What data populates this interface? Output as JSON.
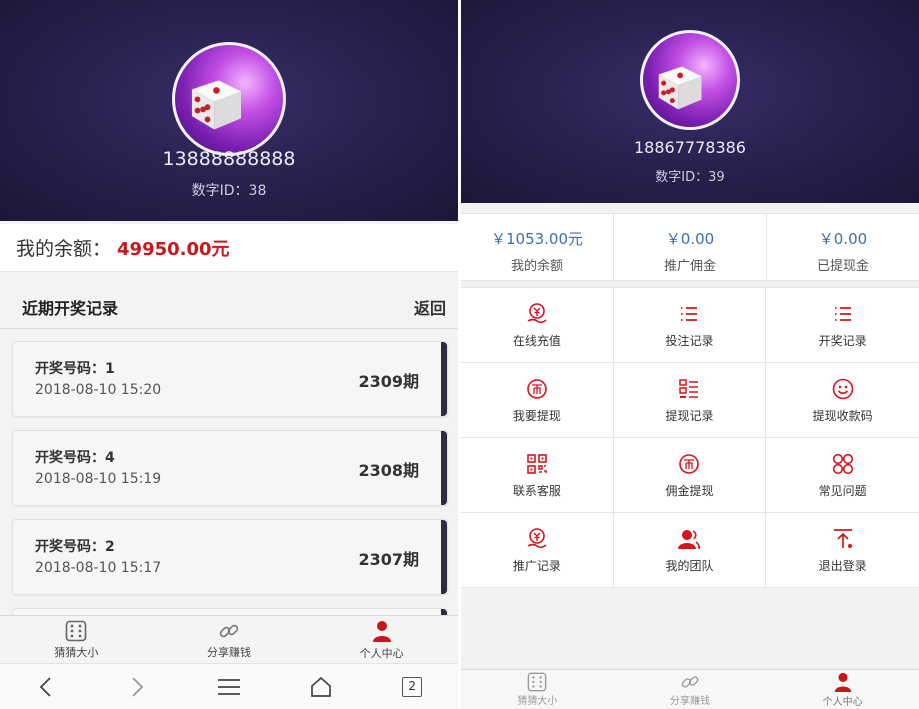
{
  "left": {
    "phone": "13888888888",
    "uid": "数字ID：38",
    "balance_label": "我的余额：",
    "balance_value": "49950.00元",
    "records_title": "近期开奖记录",
    "back_label": "返回",
    "records": [
      {
        "num": "开奖号码：1",
        "time": "2018-08-10 15:20",
        "period": "2309期"
      },
      {
        "num": "开奖号码：4",
        "time": "2018-08-10 15:19",
        "period": "2308期"
      },
      {
        "num": "开奖号码：2",
        "time": "2018-08-10 15:17",
        "period": "2307期"
      }
    ],
    "tabs": [
      {
        "label": "猜猜大小",
        "icon": "dice-icon"
      },
      {
        "label": "分享赚钱",
        "icon": "link-icon"
      },
      {
        "label": "个人中心",
        "icon": "person-icon"
      }
    ],
    "browser": {
      "tab_count": "2"
    }
  },
  "right": {
    "phone": "18867778386",
    "uid": "数字ID：39",
    "stats": [
      {
        "value": "￥1053.00元",
        "label": "我的余额"
      },
      {
        "value": "￥0.00",
        "label": "推广佣金"
      },
      {
        "value": "￥0.00",
        "label": "已提现金"
      }
    ],
    "menu": [
      {
        "label": "在线充值",
        "icon": "yen-hand-icon"
      },
      {
        "label": "投注记录",
        "icon": "list-icon"
      },
      {
        "label": "开奖记录",
        "icon": "list-icon"
      },
      {
        "label": "我要提现",
        "icon": "coin-icon"
      },
      {
        "label": "提现记录",
        "icon": "grid-list-icon"
      },
      {
        "label": "提现收款码",
        "icon": "smile-icon"
      },
      {
        "label": "联系客服",
        "icon": "qrcode-icon"
      },
      {
        "label": "佣金提现",
        "icon": "coin-icon"
      },
      {
        "label": "常见问题",
        "icon": "circles-icon"
      },
      {
        "label": "推广记录",
        "icon": "yen-hand-icon"
      },
      {
        "label": "我的团队",
        "icon": "team-icon"
      },
      {
        "label": "退出登录",
        "icon": "logout-icon"
      }
    ],
    "tabs": [
      {
        "label": "猜猜大小",
        "icon": "dice-icon"
      },
      {
        "label": "分享赚钱",
        "icon": "link-icon"
      },
      {
        "label": "个人中心",
        "icon": "person-icon"
      }
    ]
  },
  "colors": {
    "accent_red": "#c8161d",
    "stat_blue": "#3d6fa8",
    "hero_bg": "#2a2150"
  }
}
